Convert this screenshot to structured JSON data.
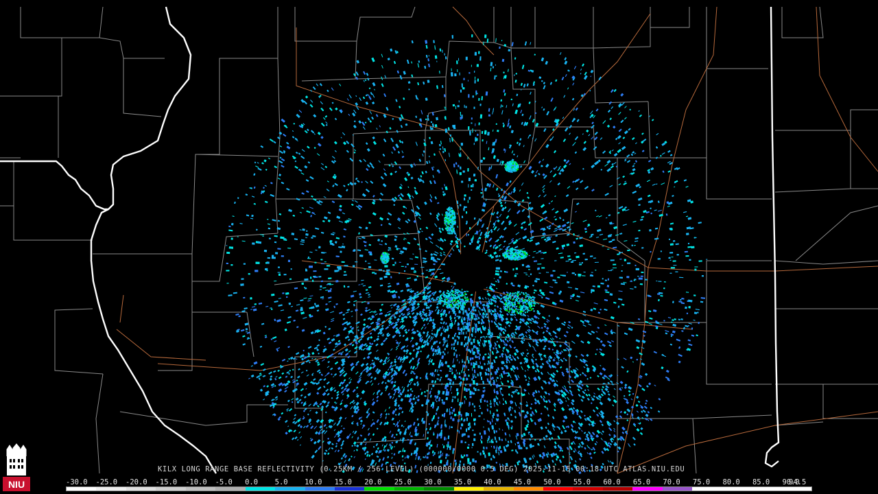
{
  "header": {
    "title": "KILX LONG RANGE BASE REFLECTIVITY (0.25KM / 256 LEVEL) (000000/0000 0.5 DEG) 2025-11-15 00:18 UTC  ATLAS.NIU.EDU"
  },
  "logo": {
    "text": "NIU",
    "icon": "niu-tower-logo"
  },
  "legend": {
    "labels": [
      "-30.0",
      "-25.0",
      "-20.0",
      "-15.0",
      "-10.0",
      "-5.0",
      "0.0",
      "5.0",
      "10.0",
      "15.0",
      "20.0",
      "25.0",
      "30.0",
      "35.0",
      "40.0",
      "45.0",
      "50.0",
      "55.0",
      "60.0",
      "65.0",
      "70.0",
      "75.0",
      "80.0",
      "85.0",
      "90.0",
      "94.5"
    ],
    "colors": [
      "#ffffff",
      "#f0f0f0",
      "#e0e0e0",
      "#d0d0d0",
      "#c0c0c0",
      "#b0b0b0",
      "#00e5e5",
      "#19b2f0",
      "#2e7df5",
      "#1a33d9",
      "#00e000",
      "#00b400",
      "#008c00",
      "#fff000",
      "#e6b400",
      "#ff8c00",
      "#ff0000",
      "#d40000",
      "#b40000",
      "#ff00ff",
      "#9955cc",
      "#ffffff",
      "#ffffff",
      "#ffffff",
      "#ffffff"
    ]
  },
  "colors": {
    "background": "#000000",
    "county_border": "#8a8a8a",
    "state_border": "#ffffff",
    "highway": "#b86a3c",
    "echo_primary": "#19b2f0",
    "echo_secondary": "#00e5e5",
    "echo_strong": "#2e7df5",
    "echo_peak": "#00e000"
  }
}
